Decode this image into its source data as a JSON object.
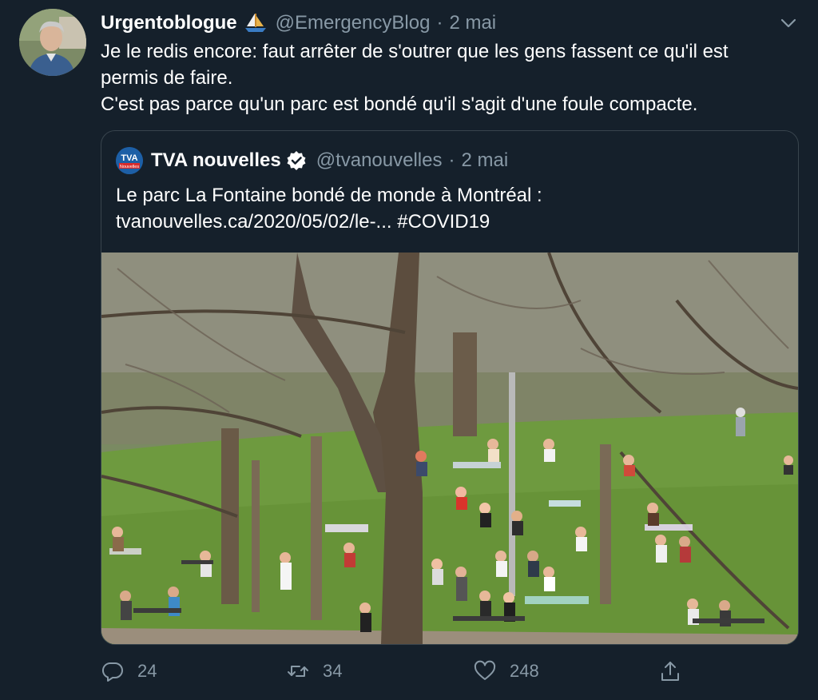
{
  "tweet": {
    "author": {
      "display_name": "Urgentoblogue",
      "badge_icon": "sailboat-icon",
      "handle": "@EmergencyBlog",
      "separator": "·",
      "date": "2 mai"
    },
    "menu_icon": "chevron-down-icon",
    "text": "Je le redis encore: faut arrêter de s'outrer que les gens fassent ce qu'il est\npermis de faire.\nC'est pas parce qu'un parc est bondé qu'il s'agit d'une foule compacte.",
    "quoted": {
      "avatar_text": "TVA",
      "avatar_subtext": "Nouvelles",
      "display_name": "TVA nouvelles",
      "verified_icon": "verified-badge-icon",
      "handle": "@tvanouvelles",
      "separator": "·",
      "date": "2 mai",
      "text_line": "Le parc La Fontaine bondé de monde à Montréal :",
      "link_line": "tvanouvelles.ca/2020/05/02/le-... #COVID19",
      "media": "park-photo"
    },
    "actions": {
      "reply": {
        "icon": "reply-icon",
        "count": "24"
      },
      "retweet": {
        "icon": "retweet-icon",
        "count": "34"
      },
      "like": {
        "icon": "heart-icon",
        "count": "248"
      },
      "share": {
        "icon": "share-icon"
      }
    }
  },
  "colors": {
    "background": "#15202b",
    "text": "#ffffff",
    "secondary": "#8899a6",
    "border": "#38444d"
  }
}
